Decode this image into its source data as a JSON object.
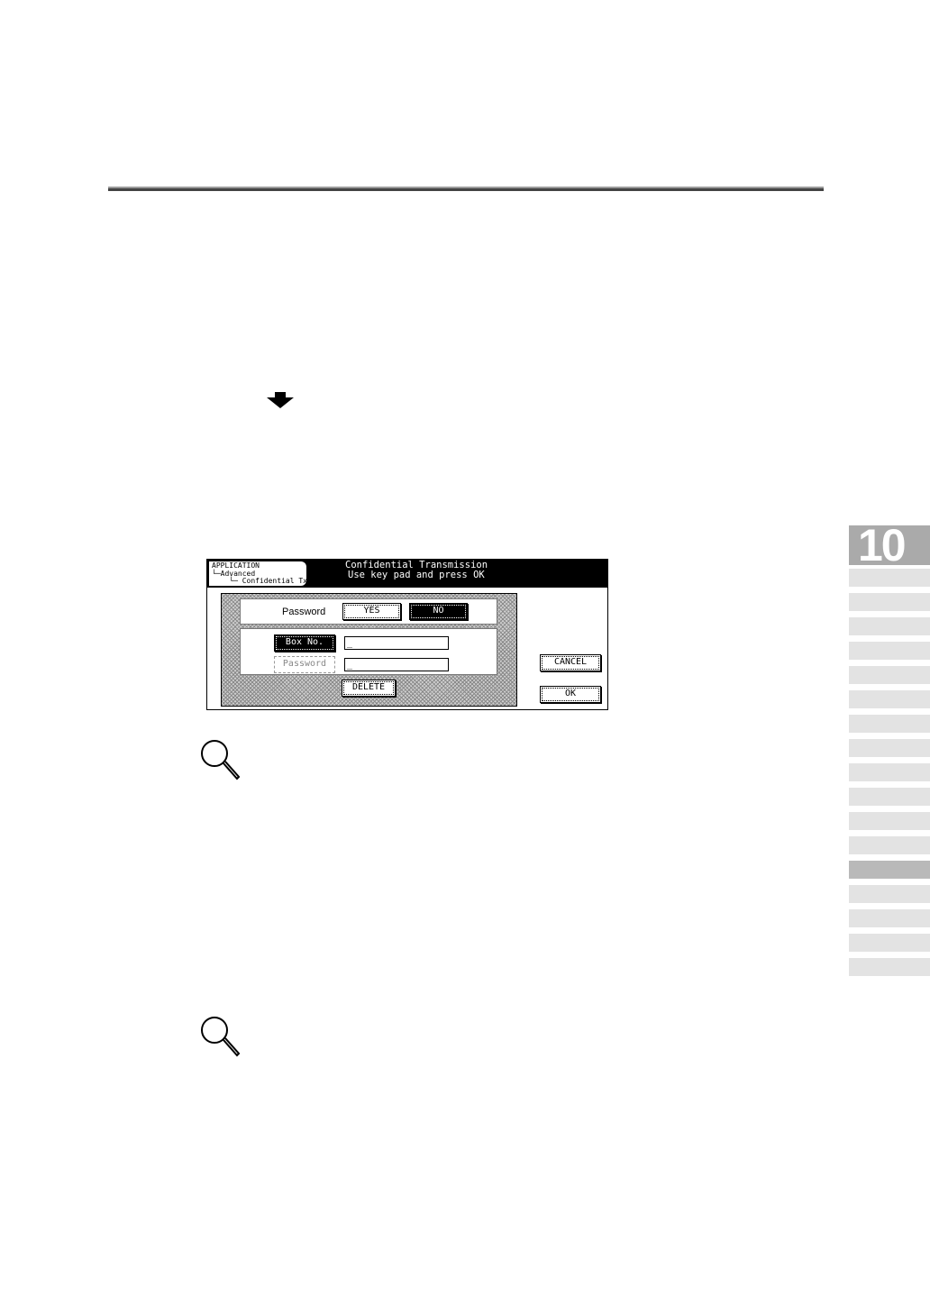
{
  "panel": {
    "breadcrumb": [
      "APPLICATION",
      "└─Advanced",
      "    └─ Confidential Tx"
    ],
    "title_line1": "Confidential Transmission",
    "title_line2": "Use key pad and press OK",
    "password_label": "Password",
    "yes_label": "YES",
    "no_label": "NO",
    "box_no_label": "Box No.",
    "password_button_label": "Password",
    "box_no_value": "_",
    "password_value": "_",
    "delete_label": "DELETE",
    "cancel_label": "CANCEL",
    "ok_label": "OK"
  },
  "chapter": {
    "number": "10",
    "active_tab_index": 12
  },
  "icons": [
    "down-arrow-icon",
    "magnifier-icon",
    "magnifier-icon"
  ]
}
